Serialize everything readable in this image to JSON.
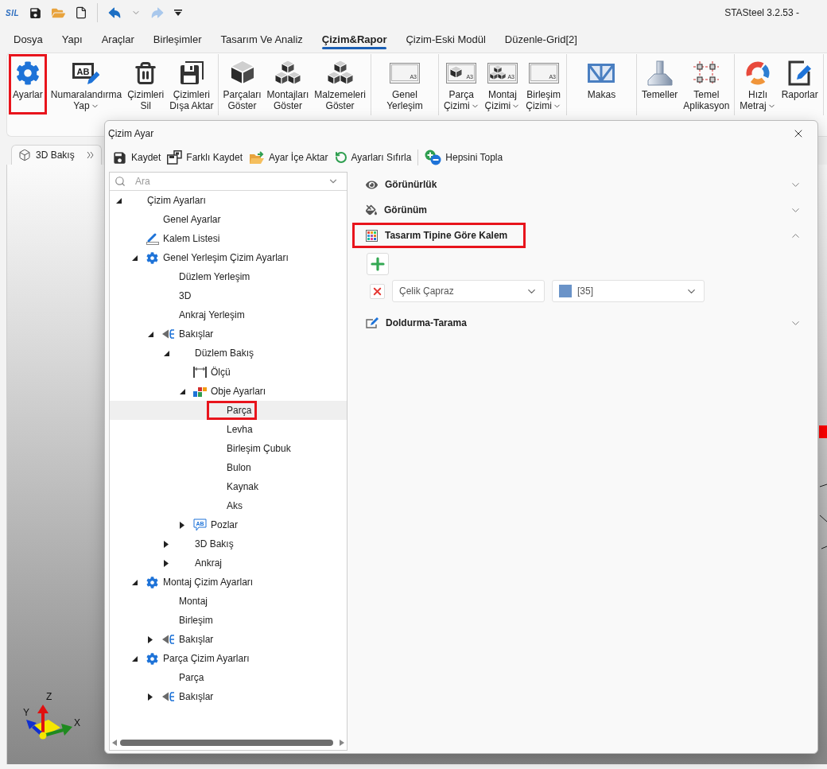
{
  "app": {
    "logo": "SIL",
    "title": "STASteel 3.2.53 -"
  },
  "quick_access": {
    "undo": {
      "disabled": false
    },
    "redo": {
      "disabled": true
    }
  },
  "menu_tabs": [
    {
      "label": "Dosya",
      "selected": false
    },
    {
      "label": "Yapı",
      "selected": false
    },
    {
      "label": "Araçlar",
      "selected": false
    },
    {
      "label": "Birleşimler",
      "selected": false
    },
    {
      "label": "Tasarım Ve Analiz",
      "selected": false
    },
    {
      "label": "Çizim&Rapor",
      "selected": true
    },
    {
      "label": "Çizim-Eski Modül",
      "selected": false
    },
    {
      "label": "Düzenle-Grid[2]",
      "selected": false
    }
  ],
  "ribbon": {
    "groups": [
      {
        "buttons": [
          {
            "lines": [
              "Ayarlar"
            ],
            "has_menu": false,
            "highlighted": true
          },
          {
            "lines": [
              "Numaralandırma",
              "Yap"
            ],
            "has_menu": true,
            "highlighted": false,
            "icon_text": "AB"
          },
          {
            "lines": [
              "Çizimleri",
              "Sil"
            ],
            "has_menu": false,
            "highlighted": false
          },
          {
            "lines": [
              "Çizimleri",
              "Dışa Aktar"
            ],
            "has_menu": false,
            "highlighted": false
          }
        ]
      },
      {
        "buttons": [
          {
            "lines": [
              "Parçaları",
              "Göster"
            ],
            "has_menu": false,
            "highlighted": false
          },
          {
            "lines": [
              "Montajları",
              "Göster"
            ],
            "has_menu": false,
            "highlighted": false
          },
          {
            "lines": [
              "Malzemeleri",
              "Göster"
            ],
            "has_menu": false,
            "highlighted": false
          }
        ]
      },
      {
        "buttons": [
          {
            "lines": [
              "Genel",
              "Yerleşim"
            ],
            "has_menu": false,
            "highlighted": false,
            "icon_text": "A3"
          }
        ]
      },
      {
        "buttons": [
          {
            "lines": [
              "Parça",
              "Çizimi"
            ],
            "has_menu": true,
            "highlighted": false,
            "icon_text": "A3"
          },
          {
            "lines": [
              "Montaj",
              "Çizimi"
            ],
            "has_menu": true,
            "highlighted": false,
            "icon_text": "A3"
          },
          {
            "lines": [
              "Birleşim",
              "Çizimi"
            ],
            "has_menu": true,
            "highlighted": false,
            "icon_text": "A3"
          }
        ]
      },
      {
        "buttons": [
          {
            "lines": [
              "Makas"
            ],
            "has_menu": false,
            "highlighted": false
          }
        ]
      },
      {
        "buttons": [
          {
            "lines": [
              "Temeller"
            ],
            "has_menu": false,
            "highlighted": false
          },
          {
            "lines": [
              "Temel",
              "Aplikasyon"
            ],
            "has_menu": false,
            "highlighted": false
          }
        ]
      },
      {
        "buttons": [
          {
            "lines": [
              "Hızlı",
              "Metraj"
            ],
            "has_menu": true,
            "highlighted": false
          },
          {
            "lines": [
              "Raporlar"
            ],
            "has_menu": false,
            "highlighted": false
          }
        ]
      }
    ]
  },
  "document_tabs": [
    {
      "label": "3D Bakış",
      "selected": true
    }
  ],
  "viewport": {
    "axis_labels": {
      "z": "Z",
      "y": "Y",
      "x": "X"
    }
  },
  "dialog": {
    "title": "Çizim Ayar",
    "toolbar": [
      {
        "label": "Kaydet"
      },
      {
        "label": "Farklı Kaydet"
      },
      {
        "label": "Ayar İçe Aktar"
      },
      {
        "label": "Ayarları Sıfırla"
      },
      {
        "label": "Hepsini Topla"
      }
    ],
    "search": {
      "placeholder": "Ara"
    },
    "tree": [
      {
        "label": "Çizim Ayarları",
        "expanded": true,
        "selected": false,
        "highlighted": false,
        "children": [
          {
            "label": "Genel Ayarlar",
            "selected": false,
            "highlighted": false
          },
          {
            "label": "Kalem Listesi",
            "selected": false,
            "highlighted": false
          },
          {
            "label": "Genel Yerleşim Çizim Ayarları",
            "expanded": true,
            "selected": false,
            "highlighted": false,
            "children": [
              {
                "label": "Düzlem Yerleşim",
                "selected": false,
                "highlighted": false
              },
              {
                "label": "3D",
                "selected": false,
                "highlighted": false
              },
              {
                "label": "Ankraj Yerleşim",
                "selected": false,
                "highlighted": false
              },
              {
                "label": "Bakışlar",
                "expanded": true,
                "selected": false,
                "highlighted": false,
                "children": [
                  {
                    "label": "Düzlem Bakış",
                    "expanded": true,
                    "selected": false,
                    "highlighted": false,
                    "children": [
                      {
                        "label": "Ölçü",
                        "selected": false,
                        "highlighted": false
                      },
                      {
                        "label": "Obje Ayarları",
                        "expanded": true,
                        "selected": false,
                        "highlighted": false,
                        "children": [
                          {
                            "label": "Parça",
                            "selected": true,
                            "highlighted": true
                          },
                          {
                            "label": "Levha",
                            "selected": false,
                            "highlighted": false
                          },
                          {
                            "label": "Birleşim Çubuk",
                            "selected": false,
                            "highlighted": false
                          },
                          {
                            "label": "Bulon",
                            "selected": false,
                            "highlighted": false
                          },
                          {
                            "label": "Kaynak",
                            "selected": false,
                            "highlighted": false
                          },
                          {
                            "label": "Aks",
                            "selected": false,
                            "highlighted": false
                          }
                        ]
                      },
                      {
                        "label": "Pozlar",
                        "expanded": false,
                        "selected": false,
                        "highlighted": false,
                        "icon_text": "AB"
                      }
                    ]
                  },
                  {
                    "label": "3D Bakış",
                    "expanded": false,
                    "selected": false,
                    "highlighted": false
                  },
                  {
                    "label": "Ankraj",
                    "expanded": false,
                    "selected": false,
                    "highlighted": false
                  }
                ]
              }
            ]
          },
          {
            "label": "Montaj Çizim Ayarları",
            "expanded": true,
            "selected": false,
            "highlighted": false,
            "children": [
              {
                "label": "Montaj",
                "selected": false,
                "highlighted": false
              },
              {
                "label": "Birleşim",
                "selected": false,
                "highlighted": false
              },
              {
                "label": "Bakışlar",
                "expanded": false,
                "selected": false,
                "highlighted": false
              }
            ]
          },
          {
            "label": "Parça Çizim Ayarları",
            "expanded": true,
            "selected": false,
            "highlighted": false,
            "children": [
              {
                "label": "Parça",
                "selected": false,
                "highlighted": false
              },
              {
                "label": "Bakışlar",
                "expanded": false,
                "selected": false,
                "highlighted": false
              }
            ]
          }
        ]
      }
    ],
    "sections": [
      {
        "title": "Görünürlük",
        "expanded": false,
        "highlighted": false
      },
      {
        "title": "Görünüm",
        "expanded": false,
        "highlighted": false
      },
      {
        "title": "Tasarım Tipine Göre Kalem",
        "expanded": true,
        "highlighted": true,
        "rules": [
          {
            "design_type": "Çelik Çapraz",
            "pen": "[35]",
            "color": "#6a93c8"
          }
        ]
      },
      {
        "title": "Doldurma-Tarama",
        "expanded": false,
        "highlighted": false
      }
    ]
  }
}
